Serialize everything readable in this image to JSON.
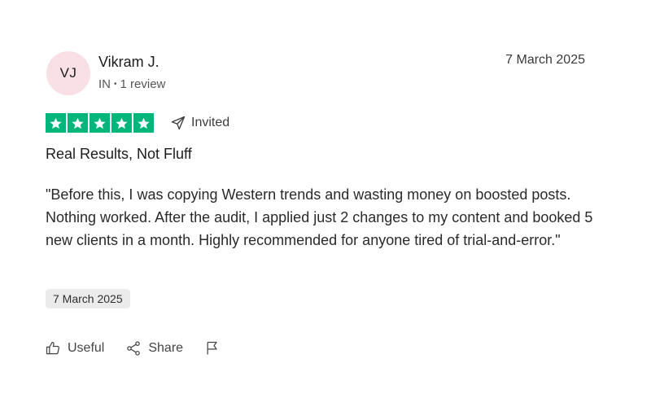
{
  "reviewer": {
    "initials": "VJ",
    "name": "Vikram J.",
    "country": "IN",
    "separator": "•",
    "review_count": "1 review",
    "avatar_bg": "#f9dfe6"
  },
  "review": {
    "date_header": "7 March 2025",
    "rating": 5,
    "max_rating": 5,
    "star_color": "#00b67a",
    "invited_label": "Invited",
    "title": "Real Results, Not Fluff",
    "body": "\"Before this, I was copying Western trends and wasting money on boosted posts. Nothing worked. After the audit, I applied just 2 changes to my content and booked 5 new clients in a month. Highly recommended for anyone tired of trial-and-error.\"",
    "date_chip": "7 March 2025"
  },
  "actions": {
    "useful_label": "Useful",
    "share_label": "Share",
    "icons": [
      "thumbs-up-icon",
      "share-icon",
      "flag-icon"
    ]
  }
}
